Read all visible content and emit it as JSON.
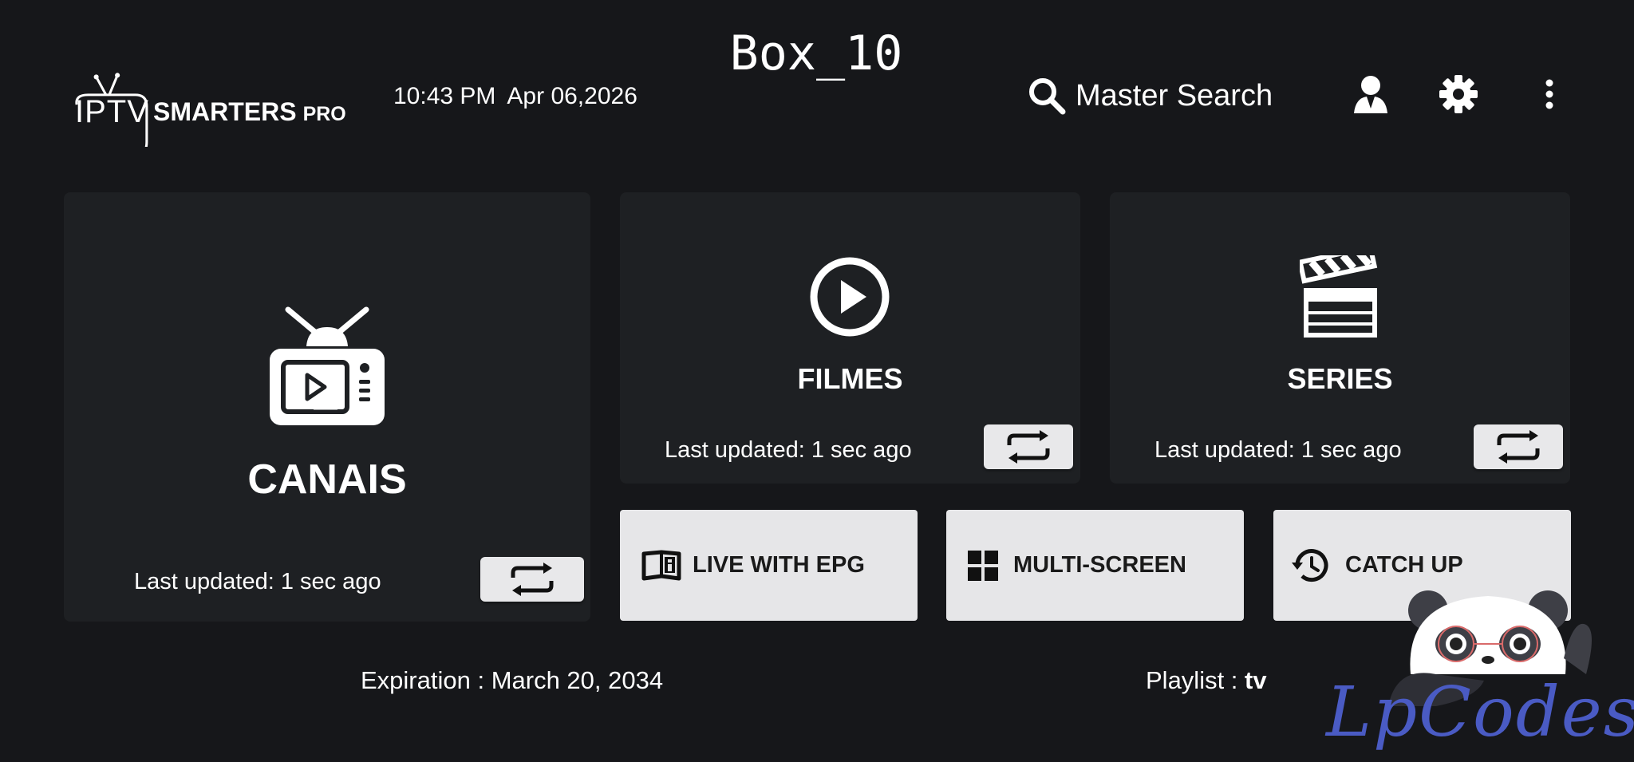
{
  "header": {
    "logo": {
      "iptv": "IPTV",
      "smarters": "SMARTERS",
      "pro": "PRO"
    },
    "time": "10:43 PM",
    "date": "Apr 06,2026",
    "title": "Box_10",
    "search_label": "Master Search",
    "icons": [
      "search-icon",
      "user-icon",
      "gear-icon",
      "more-vertical-icon"
    ]
  },
  "cards": {
    "canais": {
      "title": "CANAIS",
      "last_updated": "Last updated: 1 sec ago",
      "icon": "tv-icon"
    },
    "filmes": {
      "title": "FILMES",
      "last_updated": "Last updated: 1 sec ago",
      "icon": "play-circle-icon"
    },
    "series": {
      "title": "SERIES",
      "last_updated": "Last updated: 1 sec ago",
      "icon": "clapperboard-icon"
    }
  },
  "buttons": {
    "live_epg": {
      "label": "LIVE WITH EPG",
      "icon": "book-info-icon"
    },
    "multi_screen": {
      "label": "MULTI-SCREEN",
      "icon": "grid-icon"
    },
    "catch_up": {
      "label": "CATCH UP",
      "icon": "history-icon"
    }
  },
  "footer": {
    "expiration": "Expiration : March 20, 2034",
    "playlist_label": "Playlist : ",
    "playlist_value": "tv"
  },
  "watermark": {
    "text": "LpCodes",
    "icon": "panda-mascot-icon"
  },
  "colors": {
    "background": "#16171a",
    "card": "#1e2023",
    "button_light": "#e6e6e8",
    "watermark": "#4a5bc4"
  }
}
